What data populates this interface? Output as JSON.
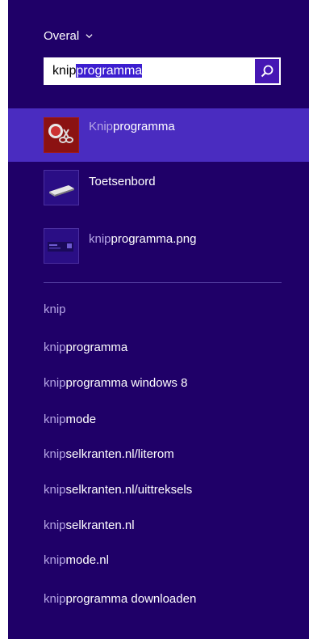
{
  "scope": {
    "label": "Overal"
  },
  "search": {
    "typed": "knip",
    "completion": "programma"
  },
  "results": [
    {
      "prefix": "Knip",
      "rest": "programma",
      "icon": "scissors-app-icon"
    },
    {
      "prefix": "",
      "rest": "Toetsenbord",
      "icon": "keyboard-icon"
    },
    {
      "prefix": "knip",
      "rest": "programma.png",
      "icon": "image-file-icon"
    }
  ],
  "suggestions": [
    {
      "prefix": "knip",
      "rest": ""
    },
    {
      "prefix": "knip",
      "rest": "programma"
    },
    {
      "prefix": "knip",
      "rest": "programma windows 8"
    },
    {
      "prefix": "knip",
      "rest": "mode"
    },
    {
      "prefix": "knip",
      "rest": "selkranten.nl/literom"
    },
    {
      "prefix": "knip",
      "rest": "selkranten.nl/uittreksels"
    },
    {
      "prefix": "knip",
      "rest": "selkranten.nl"
    },
    {
      "prefix": "knip",
      "rest": "mode.nl"
    },
    {
      "prefix": "knip",
      "rest": "programma downloaden"
    }
  ],
  "colors": {
    "pane": "#1f0068",
    "selected": "#4a2cc0",
    "accent": "#4617b4",
    "dim_text": "#b6a6e6"
  }
}
